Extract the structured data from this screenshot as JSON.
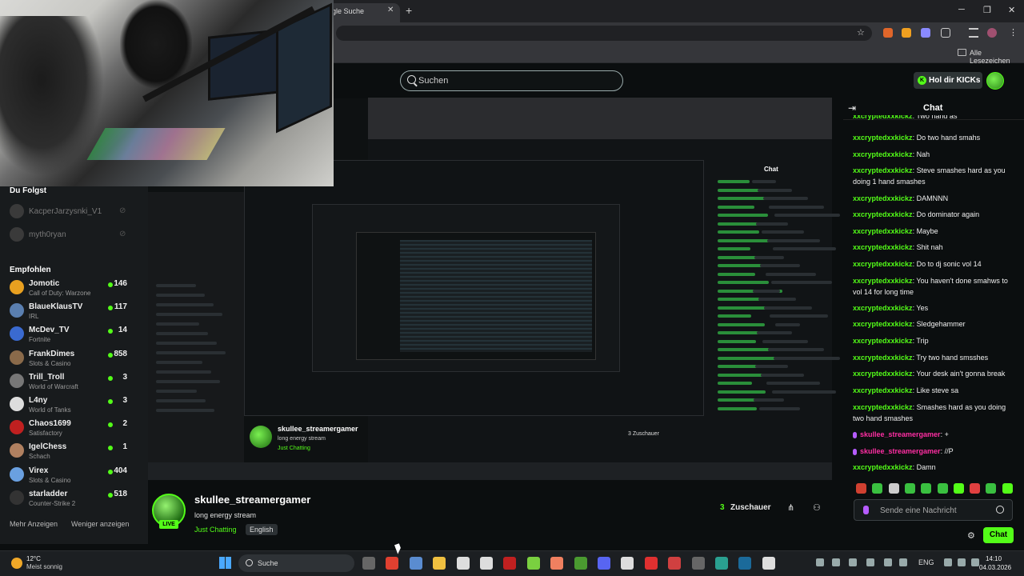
{
  "browser": {
    "tab_title": "gle Suche",
    "tab_close": "✕",
    "new_tab": "+",
    "window_controls": [
      "─",
      "❐",
      "✕"
    ],
    "bookmarks_label": "Alle Lesezeichen"
  },
  "header": {
    "search_placeholder": "Suchen",
    "kicks_button": "Hol dir KICKs",
    "kicks_icon": "K"
  },
  "sidebar": {
    "followed_title": "Du Folgst",
    "followed": [
      "KacperJarzysnki_V1",
      "myth0ryan"
    ],
    "recommended_title": "Empfohlen",
    "channels": [
      {
        "name": "Jomotic",
        "category": "Call of Duty: Warzone",
        "viewers": "146",
        "color": "#e8a020"
      },
      {
        "name": "BlaueKlausTV",
        "category": "IRL",
        "viewers": "117",
        "color": "#5a7fb0"
      },
      {
        "name": "McDev_TV",
        "category": "Fortnite",
        "viewers": "14",
        "color": "#3a6ad0"
      },
      {
        "name": "FrankDimes",
        "category": "Slots & Casino",
        "viewers": "858",
        "color": "#8a6a4a"
      },
      {
        "name": "Trill_Troll",
        "category": "World of Warcraft",
        "viewers": "3",
        "color": "#777"
      },
      {
        "name": "L4ny",
        "category": "World of Tanks",
        "viewers": "3",
        "color": "#ddd"
      },
      {
        "name": "Chaos1699",
        "category": "Satisfactory",
        "viewers": "2",
        "color": "#c02020"
      },
      {
        "name": "IgelChess",
        "category": "Schach",
        "viewers": "1",
        "color": "#b08060"
      },
      {
        "name": "Virex",
        "category": "Slots & Casino",
        "viewers": "404",
        "color": "#6aa0e0"
      },
      {
        "name": "starladder",
        "category": "Counter-Strike 2",
        "viewers": "518",
        "color": "#333"
      }
    ],
    "show_more": "Mehr Anzeigen",
    "show_less": "Weniger anzeigen"
  },
  "stream": {
    "streamer": "skullee_streamergamer",
    "title": "long energy stream",
    "category": "Just Chatting",
    "language": "English",
    "live_badge": "LIVE",
    "viewer_count": "3",
    "viewer_label": "Zuschauer",
    "nested_viewers": "3 Zuschauer",
    "nested_chat_title": "Chat"
  },
  "chat": {
    "title": "Chat",
    "messages": [
      {
        "user": "xxcryptedxxkickz",
        "text": "Two hand as",
        "pink": false
      },
      {
        "user": "xxcryptedxxkickz",
        "text": "Do two hand smahs",
        "pink": false
      },
      {
        "user": "xxcryptedxxkickz",
        "text": "Nah",
        "pink": false
      },
      {
        "user": "xxcryptedxxkickz",
        "text": "Steve smashes hard as you doing 1 hand smashes",
        "pink": false
      },
      {
        "user": "xxcryptedxxkickz",
        "text": "DAMNNN",
        "pink": false
      },
      {
        "user": "xxcryptedxxkickz",
        "text": "Do dominator again",
        "pink": false
      },
      {
        "user": "xxcryptedxxkickz",
        "text": "Maybe",
        "pink": false
      },
      {
        "user": "xxcryptedxxkickz",
        "text": "Shit nah",
        "pink": false
      },
      {
        "user": "xxcryptedxxkickz",
        "text": "Do to dj sonic vol 14",
        "pink": false
      },
      {
        "user": "xxcryptedxxkickz",
        "text": "You haven't done smahws to vol 14 for long time",
        "pink": false
      },
      {
        "user": "xxcryptedxxkickz",
        "text": "Yes",
        "pink": false
      },
      {
        "user": "xxcryptedxxkickz",
        "text": "Sledgehammer",
        "pink": false
      },
      {
        "user": "xxcryptedxxkickz",
        "text": "Trip",
        "pink": false
      },
      {
        "user": "xxcryptedxxkickz",
        "text": "Try two hand smsshes",
        "pink": false
      },
      {
        "user": "xxcryptedxxkickz",
        "text": "Your desk ain't gonna break",
        "pink": false
      },
      {
        "user": "xxcryptedxxkickz",
        "text": "Like steve sa",
        "pink": false
      },
      {
        "user": "xxcryptedxxkickz",
        "text": "Smashes hard as you doing two hand smashes",
        "pink": false
      },
      {
        "user": "skullee_streamergamer",
        "text": "+",
        "pink": true
      },
      {
        "user": "skullee_streamergamer",
        "text": "//P",
        "pink": true
      },
      {
        "user": "xxcryptedxxkickz",
        "text": "Damn",
        "pink": false
      }
    ],
    "input_placeholder": "Sende eine Nachricht",
    "send_button": "Chat"
  },
  "taskbar": {
    "weather_temp": "12°C",
    "weather_desc": "Meist sonnig",
    "search_label": "Suche",
    "language": "ENG",
    "time": "14:10",
    "date": "04.03.2026"
  }
}
